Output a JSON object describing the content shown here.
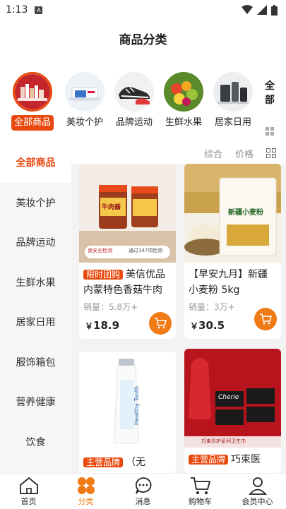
{
  "status": {
    "time": "1:13",
    "badge": "A"
  },
  "header": {
    "title": "商品分类"
  },
  "categories": [
    {
      "label": "全部商品",
      "icon": "all-products-image"
    },
    {
      "label": "美妆个护",
      "icon": "cosmetics-image"
    },
    {
      "label": "品牌运动",
      "icon": "sneakers-image"
    },
    {
      "label": "生鲜水果",
      "icon": "fruits-image"
    },
    {
      "label": "居家日用",
      "icon": "appliances-image"
    }
  ],
  "all_more": "全部",
  "sidebar": [
    "全部商品",
    "美妆个护",
    "品牌运动",
    "生鲜水果",
    "居家日用",
    "服饰箱包",
    "营养健康",
    "饮食"
  ],
  "sort": {
    "comprehensive": "综合",
    "price": "价格"
  },
  "products": [
    {
      "tag": "限时团购",
      "name": "美信优品 内蒙特色香菇牛肉酱",
      "sold": "销量：5.8万+",
      "price_symbol": "￥",
      "price": "18.9",
      "img_text": {
        "brand": "牛肉酱",
        "banner": "食安全检测",
        "banner2": "通过147项检测"
      }
    },
    {
      "tag": "",
      "name": "【早安九月】新疆小麦粉 5kg",
      "sold": "销量：3万+",
      "price_symbol": "￥",
      "price": "30.5",
      "img_text": {
        "brand": "新疆小麦粉"
      }
    },
    {
      "tag": "主营品牌",
      "name": "（无",
      "sold": "",
      "price_symbol": "",
      "price": "",
      "img_text": {
        "brand": "Healthy Tooth"
      }
    },
    {
      "tag": "主营品牌",
      "name": "巧束医",
      "sold": "",
      "price_symbol": "",
      "price": "",
      "img_text": {
        "brand": "Cherie",
        "banner": "巧束珍护系列卫生巾"
      }
    }
  ],
  "tabbar": [
    {
      "label": "首页",
      "icon": "home-icon"
    },
    {
      "label": "分类",
      "icon": "category-icon"
    },
    {
      "label": "消息",
      "icon": "message-icon"
    },
    {
      "label": "购物车",
      "icon": "cart-icon"
    },
    {
      "label": "会员中心",
      "icon": "user-icon"
    }
  ],
  "colors": {
    "accent": "#e8490f",
    "cart": "#f07a16"
  }
}
